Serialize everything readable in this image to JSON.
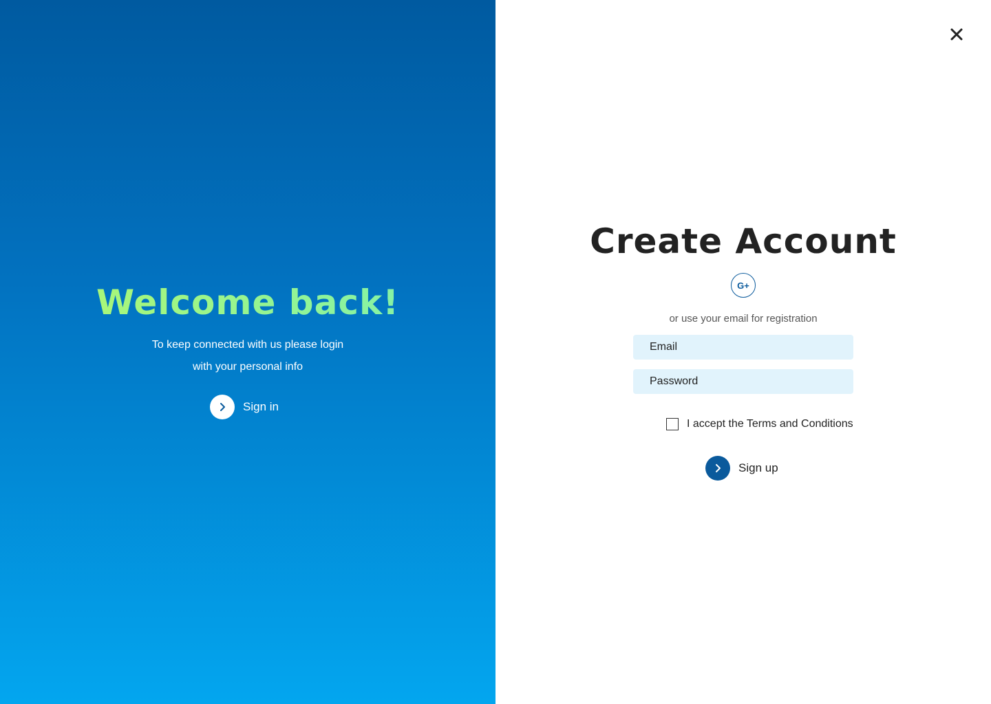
{
  "left": {
    "title": "Welcome back!",
    "subtitle_line1": "To keep connected with us please login",
    "subtitle_line2": "with your personal info",
    "signin_label": "Sign in"
  },
  "right": {
    "title": "Create Account",
    "google_label": "G+",
    "or_text": "or use your email for registration",
    "email_placeholder": "Email",
    "password_placeholder": "Password",
    "terms_label": "I accept the Terms and Conditions",
    "signup_label": "Sign up",
    "terms_checked": false
  },
  "icons": {
    "close": "close-icon",
    "chevron": "chevron-right-icon",
    "google": "google-plus-icon"
  },
  "colors": {
    "gradient_top": "#005aa0",
    "gradient_bottom": "#03a6ef",
    "title_gradient_start": "#b3f86c",
    "title_gradient_end": "#7bf1b3",
    "accent": "#0a5a9c",
    "field_bg": "#e1f3fc"
  }
}
